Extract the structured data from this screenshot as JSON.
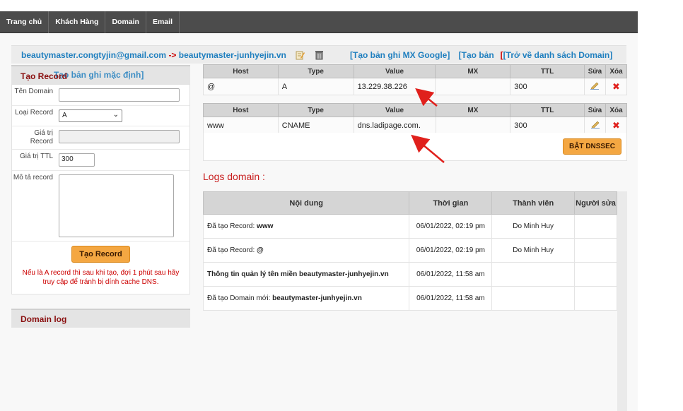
{
  "nav": {
    "items": [
      {
        "label": "Trang chủ"
      },
      {
        "label": "Khách Hàng"
      },
      {
        "label": "Domain"
      },
      {
        "label": "Email"
      }
    ]
  },
  "domain_bar": {
    "email": "beautymaster.congtyjin@gmail.com",
    "arrow": "->",
    "domain": "beautymaster-junhyejin.vn",
    "link_mx": "[Tạo bản ghi MX Google]",
    "link_create_prefix": "[Tạo bản",
    "link_back": "[Trở về danh sách Domain",
    "link_back_close": "]",
    "edit_icon": "edit-icon",
    "trash_icon": "trash-icon"
  },
  "sidebar": {
    "title": "Tạo Record",
    "overlap_text": "Tạo bản ghi mặc định]",
    "form": {
      "ten_domain_label": "Tên Domain",
      "loai_record_label": "Loại Record",
      "loai_record_value": "A",
      "gia_tri_record_label": "Giá trị Record",
      "gia_tri_ttl_label": "Giá trị TTL",
      "ttl_value": "300",
      "mo_ta_label": "Mô tả record",
      "submit_label": "Tạo Record",
      "note": "Nếu là A record thì sau khi tạo, đợi 1 phút sau hãy truy cập để tránh bị dính cache DNS."
    },
    "log_title": "Domain log"
  },
  "records": {
    "headers": [
      "Host",
      "Type",
      "Value",
      "MX",
      "TTL",
      "Sửa",
      "Xóa"
    ],
    "rows": [
      {
        "host": "@",
        "type": "A",
        "value": "13.229.38.226",
        "mx": "",
        "ttl": "300"
      },
      {
        "host": "www",
        "type": "CNAME",
        "value": "dns.ladipage.com.",
        "mx": "",
        "ttl": "300"
      }
    ],
    "dnssec_button": "BẬT DNSSEC"
  },
  "logs": {
    "title": "Logs domain :",
    "headers": [
      "Nội dung",
      "Thời gian",
      "Thành viên",
      "Người sửa"
    ],
    "rows": [
      {
        "prefix": "Đã tạo Record: ",
        "bold": "www",
        "time": "06/01/2022, 02:19 pm",
        "member": "Do Minh Huy",
        "editor": ""
      },
      {
        "prefix": "Đã tạo Record: ",
        "bold": "@",
        "time": "06/01/2022, 02:19 pm",
        "member": "Do Minh Huy",
        "editor": ""
      },
      {
        "prefix": "",
        "bold": "Thông tin quản lý tên miền beautymaster-junhyejin.vn",
        "time": "06/01/2022, 11:58 am",
        "member": "",
        "editor": ""
      },
      {
        "prefix": "Đã tạo Domain mới: ",
        "bold": "beautymaster-junhyejin.vn",
        "time": "06/01/2022, 11:58 am",
        "member": "",
        "editor": ""
      }
    ]
  },
  "colors": {
    "navbar": "#4c4c4c",
    "link_blue": "#1f7fbf",
    "accent_red": "#c00000",
    "button_orange": "#f4a742",
    "annotation_arrow": "#e0201c"
  }
}
